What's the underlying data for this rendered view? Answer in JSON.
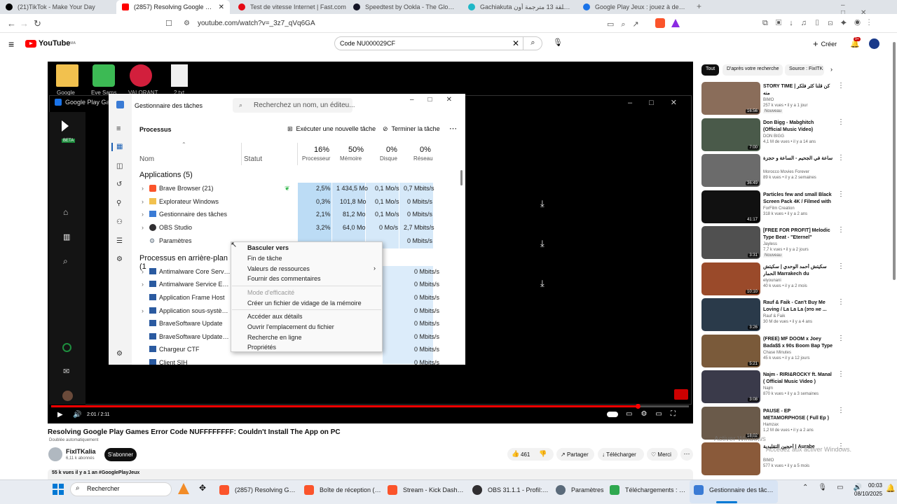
{
  "browser": {
    "tabs": [
      {
        "label": "(21)TikTok - Make Your Day",
        "color": "#000000"
      },
      {
        "label": "(2857) Resolving Google Play Ga",
        "color": "#ff0000"
      },
      {
        "label": "Test de vitesse Internet | Fast.com",
        "color": "#e50914"
      },
      {
        "label": "Speedtest by Ookla - The Global Bro",
        "color": "#141526"
      },
      {
        "label": "Gachiakuta الحلقة 13 مترجمة أون",
        "color": "#1fb7c7"
      },
      {
        "label": "Google Play Jeux : jouez à des jeux s",
        "color": "#1a73e8"
      }
    ],
    "url": "youtube.com/watch?v=_3z7_qVq6GA"
  },
  "youtube": {
    "logo": "YouTube",
    "region": "MA",
    "search_value": "Code NU000029CF",
    "create_label": "Créer",
    "notif_count": "9+",
    "filters": [
      "Tout",
      "D'après votre recherche",
      "Source : FixITK"
    ],
    "video_title": "Resolving Google Play Games Error Code NUFFFFFFFF: Couldn't Install The App on PC",
    "dubbing": "Doublée automatiquement",
    "channel": "FixITKalia",
    "subs": "6,11 k abonnés",
    "subscribe": "S'abonner",
    "likes": "461",
    "share": "Partager",
    "download": "Télécharger",
    "thanks": "Merci",
    "views": "55 k vues  il y a 1 an  #GooglePlayJeux",
    "time": "2:01 / 2:11",
    "progress": 0.92
  },
  "desktop": {
    "icons": [
      "Google",
      "Eve Sams",
      "VALORANT",
      "2.txt"
    ],
    "gp_window_title": "Google Play Games"
  },
  "taskmgr": {
    "title": "Gestionnaire des tâches",
    "search": "Recherchez un nom, un éditeu...",
    "section": "Processus",
    "run_task": "Exécuter une nouvelle tâche",
    "end_task": "Terminer la tâche",
    "cols": {
      "name": "Nom",
      "status": "Statut",
      "cpu_pct": "16%",
      "cpu": "Processeur",
      "mem_pct": "50%",
      "mem": "Mémoire",
      "disk_pct": "0%",
      "disk": "Disque",
      "net_pct": "0%",
      "net": "Réseau"
    },
    "apps_header": "Applications (5)",
    "apps": [
      {
        "name": "Brave Browser (21)",
        "cpu": "2,5%",
        "mem": "1 434,5 Mo",
        "disk": "0,1 Mo/s",
        "net": "0,7 Mbits/s"
      },
      {
        "name": "Explorateur Windows",
        "cpu": "0,3%",
        "mem": "101,8 Mo",
        "disk": "0,1 Mo/s",
        "net": "0 Mbits/s"
      },
      {
        "name": "Gestionnaire des tâches",
        "cpu": "2,1%",
        "mem": "81,2 Mo",
        "disk": "0,1 Mo/s",
        "net": "0 Mbits/s"
      },
      {
        "name": "OBS Studio",
        "cpu": "3,2%",
        "mem": "64,0 Mo",
        "disk": "0 Mo/s",
        "net": "2,7 Mbits/s"
      },
      {
        "name": "Paramètres",
        "cpu": "0%",
        "mem": "0 Mo",
        "disk": "0 Mo/s",
        "net": "0 Mbits/s"
      }
    ],
    "bg_header": "Processus en arrière-plan (1",
    "bg": [
      {
        "name": "Antimalware Core Service",
        "net": "0 Mbits/s"
      },
      {
        "name": "Antimalware Service Executal",
        "net": "0 Mbits/s"
      },
      {
        "name": "Application Frame Host",
        "net": "0 Mbits/s"
      },
      {
        "name": "Application sous-système sp",
        "net": "0 Mbits/s"
      },
      {
        "name": "BraveSoftware Update",
        "net": "0 Mbits/s"
      },
      {
        "name": "BraveSoftware Update (32 bit",
        "net": "0 Mbits/s"
      },
      {
        "name": "Chargeur CTF",
        "net": "0 Mbits/s"
      },
      {
        "name": "Client SIH",
        "net": "0 Mbits/s"
      }
    ],
    "context": [
      "Basculer vers",
      "Fin de tâche",
      "Valeurs de ressources",
      "Fournir des commentaires",
      "Mode d'efficacité",
      "Créer un fichier de vidage de la mémoire",
      "Accéder aux détails",
      "Ouvrir l'emplacement du fichier",
      "Recherche en ligne",
      "Propriétés"
    ]
  },
  "recs": [
    {
      "title": "STORY TIME | كن قلنا كثر فلكر منه",
      "ch": "BIMO",
      "meta": "257 k vues • il y a 1 jour",
      "badge": "Nouveau",
      "dur": "16:56",
      "color": "#8a6d5a"
    },
    {
      "title": "Don Bigg - Mabghitch (Official Music Video)",
      "ch": "DON BIGG",
      "meta": "4,1 M de vues • il y a 14 ans",
      "badge": "",
      "dur": "7:00",
      "color": "#4a5a4a"
    },
    {
      "title": "ساعة في الجحيم - الساعة و حجزة",
      "ch": "Morocco Movies Forever",
      "meta": "89 k vues • il y a 2 semaines",
      "badge": "",
      "dur": "36:49",
      "color": "#6b6b6b"
    },
    {
      "title": "Particles few and small Black Screen Pack 4K / Filmed with ...",
      "ch": "ForFilm Creation",
      "meta": "318 k vues • il y a 2 ans",
      "badge": "",
      "dur": "41:17",
      "color": "#111111"
    },
    {
      "title": "[FREE FOR PROFIT] Melodic Type Beat - \"Eternel\"",
      "ch": "Jayless",
      "meta": "7,7 k vues • il y a 2 jours",
      "badge": "Nouveau",
      "dur": "3:31",
      "color": "#505050"
    },
    {
      "title": "سكيتش أحمد الوحدي | سكيتش الحمار Marrakech du",
      "ch": "elyounani",
      "meta": "40 k vues • il y a 2 mois",
      "badge": "",
      "dur": "10:10",
      "color": "#9a4a2a"
    },
    {
      "title": "Rauf & Faik - Can't Buy Me Loving / La La La (это не ...",
      "ch": "Rauf & Faik",
      "meta": "30 M de vues • il y a 4 ans",
      "badge": "",
      "dur": "3:26",
      "color": "#2a3a4a"
    },
    {
      "title": "(FREE) MF DOOM x Joey Bada$$ x 90s Boom Bap Type ...",
      "ch": "Chase Minutes",
      "meta": "45 k vues • il y a 12 jours",
      "badge": "",
      "dur": "5:21",
      "color": "#7a5a3a"
    },
    {
      "title": "Najm - RIRI&ROCKY ft. Manal ( Official Music Video )",
      "ch": "Najm",
      "meta": "870 k vues • il y a 3 semaines",
      "badge": "",
      "dur": "3:08",
      "color": "#3a3a4a"
    },
    {
      "title": "PAUSE - EP METAMORPHOSE ( Full Ep )",
      "ch": "Hamzax",
      "meta": "1,2 M de vues • il y a 2 ans",
      "badge": "",
      "dur": "18:02",
      "color": "#6a5a4a"
    },
    {
      "title": "أحجين التقليدية | Aurabe",
      "ch": "BIMO",
      "meta": "577 k vues • il y a 5 mois",
      "badge": "",
      "dur": "",
      "color": "#8a5a3a"
    }
  ],
  "watermark": {
    "line1": "Activer Windows",
    "line2": "Accédez aux activer Windows."
  },
  "taskbar": {
    "search": "Rechercher",
    "items": [
      {
        "label": "(2857) Resolving Google",
        "color": "#fb542b"
      },
      {
        "label": "Boîte de réception (3 21",
        "color": "#fb542b"
      },
      {
        "label": "Stream - Kick Dashboa",
        "color": "#fb542b"
      },
      {
        "label": "OBS 31.1.1 - Profil: Sans",
        "color": "#302e31"
      },
      {
        "label": "Paramètres",
        "color": "#5a6a7a"
      },
      {
        "label": "Téléchargements : Expl",
        "color": "#2fa84f"
      },
      {
        "label": "Gestionnaire des tâches",
        "color": "#3a7bd5"
      }
    ],
    "time": "00:03",
    "date": "08/10/2025"
  }
}
